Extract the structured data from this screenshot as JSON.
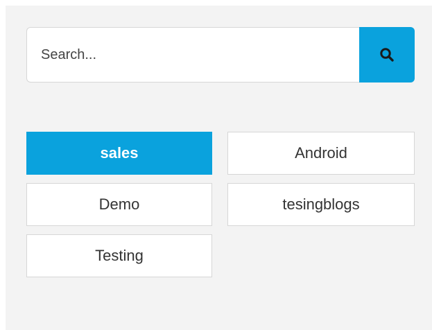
{
  "search": {
    "placeholder": "Search...",
    "value": "",
    "button_icon": "search-icon"
  },
  "tags": [
    {
      "label": "sales",
      "active": true
    },
    {
      "label": "Android",
      "active": false
    },
    {
      "label": "Demo",
      "active": false
    },
    {
      "label": "tesingblogs",
      "active": false
    },
    {
      "label": "Testing",
      "active": false
    }
  ],
  "colors": {
    "accent": "#0aa2dd",
    "panel_background": "#f3f3f3",
    "border": "#d6d6d6"
  }
}
